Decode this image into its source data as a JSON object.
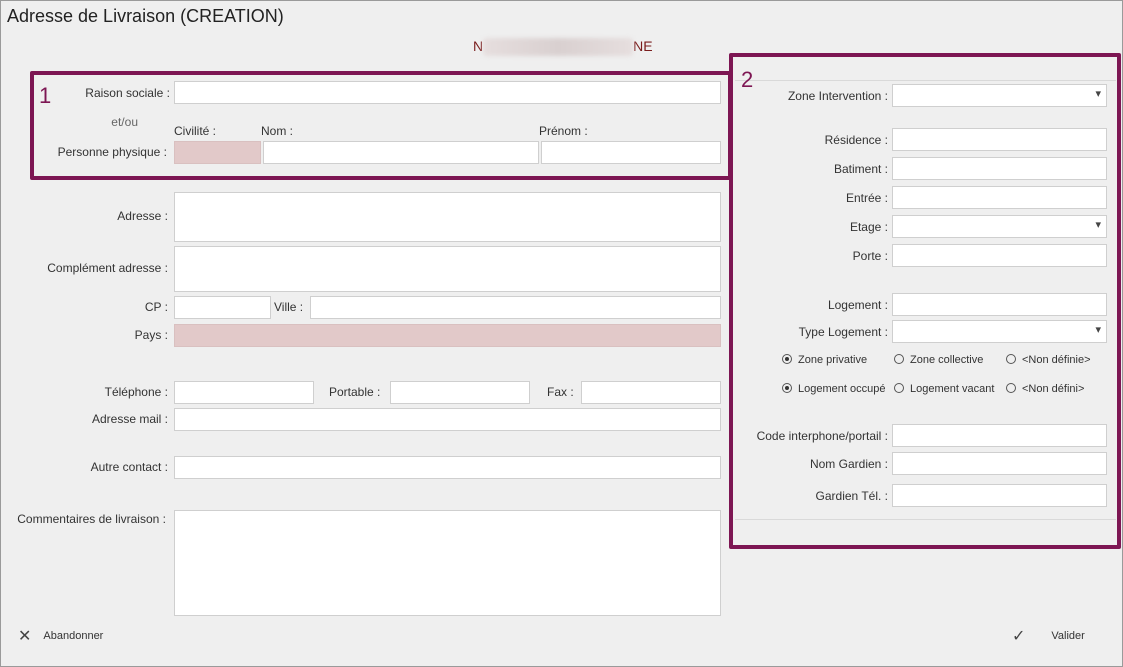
{
  "window": {
    "title": "Adresse de Livraison (CREATION)",
    "subtitle_left": "N",
    "subtitle_right": "NE"
  },
  "section1": {
    "marker": "1",
    "raison_sociale_label": "Raison sociale :",
    "etou_label": "et/ou",
    "civilite_label": "Civilité :",
    "nom_label": "Nom :",
    "prenom_label": "Prénom :",
    "personne_label": "Personne physique :"
  },
  "address": {
    "adresse_label": "Adresse :",
    "complement_label": "Complément adresse :",
    "cp_label": "CP :",
    "ville_label": "Ville :",
    "pays_label": "Pays :",
    "telephone_label": "Téléphone :",
    "portable_label": "Portable :",
    "fax_label": "Fax :",
    "mail_label": "Adresse mail :",
    "autre_contact_label": "Autre contact :",
    "commentaires_label": "Commentaires de livraison :"
  },
  "section2": {
    "marker": "2",
    "zone_intervention_label": "Zone Intervention :",
    "residence_label": "Résidence :",
    "batiment_label": "Batiment :",
    "entree_label": "Entrée :",
    "etage_label": "Etage :",
    "porte_label": "Porte :",
    "logement_label": "Logement :",
    "type_logement_label": "Type Logement :",
    "zone_radios": [
      {
        "label": "Zone privative",
        "checked": true
      },
      {
        "label": "Zone collective",
        "checked": false
      },
      {
        "label": "<Non définie>",
        "checked": false
      }
    ],
    "logement_radios": [
      {
        "label": "Logement occupé",
        "checked": true
      },
      {
        "label": "Logement vacant",
        "checked": false
      },
      {
        "label": "<Non défini>",
        "checked": false
      }
    ],
    "interphone_label": "Code interphone/portail :",
    "nom_gardien_label": "Nom Gardien :",
    "gardien_tel_label": "Gardien Tél. :"
  },
  "footer": {
    "cancel_label": "Abandonner",
    "cancel_icon": "close-icon",
    "validate_label": "Valider",
    "validate_icon": "check-icon"
  },
  "colors": {
    "highlight": "#7d1653",
    "disabled_field": "#e2c9c9",
    "subtitle": "#7a1d1d"
  }
}
